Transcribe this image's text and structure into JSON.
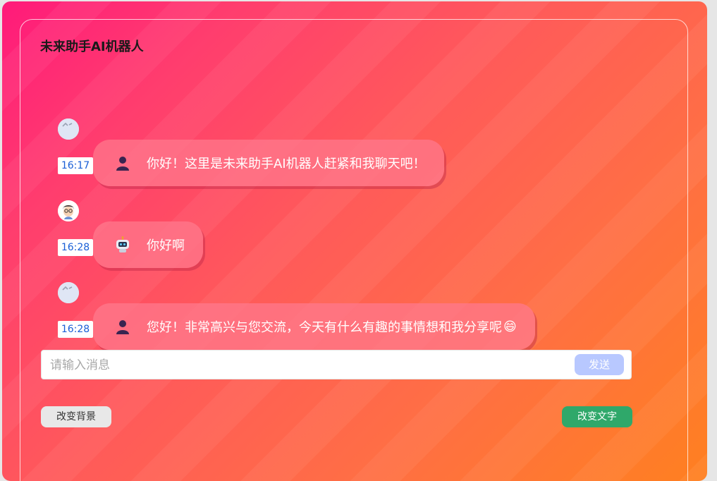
{
  "app": {
    "title": "未来助手AI机器人"
  },
  "messages": [
    {
      "sender": "bot",
      "avatar_icon": "broken-image-icon",
      "bubble_icon": "person-icon",
      "time": "16:17",
      "text": "你好！这里是未来助手AI机器人赶紧和我聊天吧！"
    },
    {
      "sender": "user",
      "avatar_icon": "user-avatar-icon",
      "bubble_icon": "robot-icon",
      "time": "16:28",
      "text": "你好啊"
    },
    {
      "sender": "bot",
      "avatar_icon": "broken-image-icon",
      "bubble_icon": "person-icon",
      "time": "16:28",
      "text": "您好！非常高兴与您交流，今天有什么有趣的事情想和我分享呢",
      "emoji": "😄"
    }
  ],
  "input": {
    "placeholder": "请输入消息",
    "value": "",
    "send_label": "发送"
  },
  "controls": {
    "change_background_label": "改变背景",
    "change_text_label": "改变文字"
  },
  "colors": {
    "send_button": "#b8c8ff",
    "change_text_button": "#2fa86a",
    "time_text": "#1a5fd6"
  }
}
